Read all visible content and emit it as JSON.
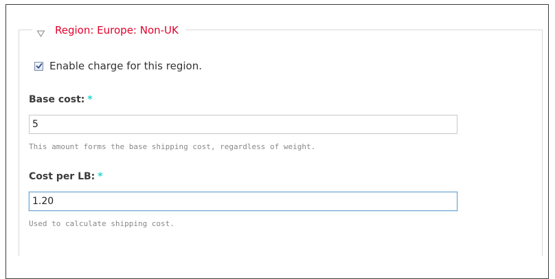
{
  "region": {
    "legend_title": "Region: Europe: Non-UK",
    "collapse_icon": "triangle-down-icon"
  },
  "enable_charge": {
    "label": "Enable charge for this region.",
    "checked": true
  },
  "base_cost": {
    "label": "Base cost:",
    "required_marker": "*",
    "value": "5",
    "description": "This amount forms the base shipping cost, regardless of weight."
  },
  "cost_per_lb": {
    "label": "Cost per LB:",
    "required_marker": "*",
    "value": "1.20",
    "description": "Used to calculate shipping cost."
  },
  "colors": {
    "legend": "#e2002b",
    "required": "#27d4cf",
    "focus_border": "#6fa7d8"
  }
}
